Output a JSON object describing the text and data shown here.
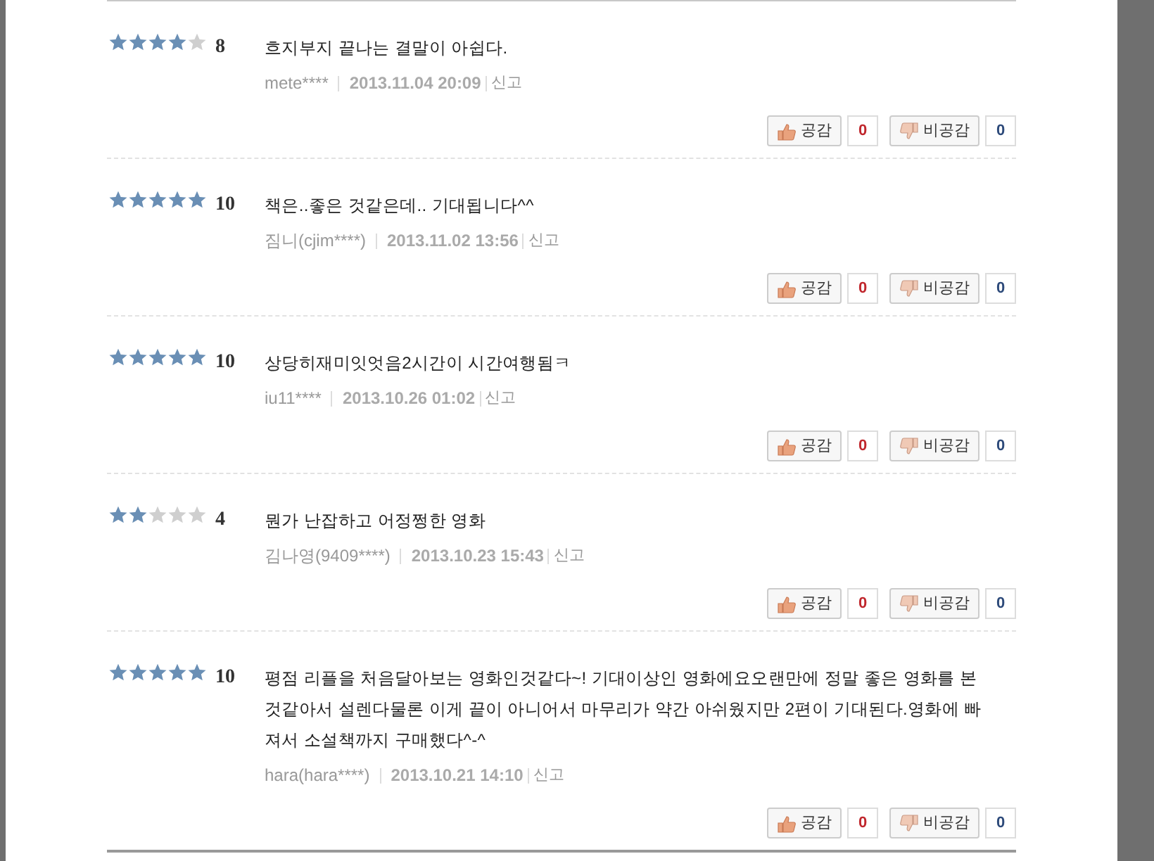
{
  "reviews": [
    {
      "stars": 4,
      "score": "8",
      "text": "흐지부지 끝나는 결말이 아쉽다.",
      "author": "mete****",
      "date": "2013.11.04 20:09",
      "report": "신고",
      "like_label": "공감",
      "like_count": "0",
      "dislike_label": "비공감",
      "dislike_count": "0"
    },
    {
      "stars": 5,
      "score": "10",
      "text": "책은..좋은 것같은데.. 기대됩니다^^",
      "author": "짐니(cjim****)",
      "date": "2013.11.02 13:56",
      "report": "신고",
      "like_label": "공감",
      "like_count": "0",
      "dislike_label": "비공감",
      "dislike_count": "0"
    },
    {
      "stars": 5,
      "score": "10",
      "text": "상당히재미잇엇음2시간이 시간여행됨ㅋ",
      "author": "iu11****",
      "date": "2013.10.26 01:02",
      "report": "신고",
      "like_label": "공감",
      "like_count": "0",
      "dislike_label": "비공감",
      "dislike_count": "0"
    },
    {
      "stars": 2,
      "score": "4",
      "text": "뭔가 난잡하고 어정쩡한 영화",
      "author": "김나영(9409****)",
      "date": "2013.10.23 15:43",
      "report": "신고",
      "like_label": "공감",
      "like_count": "0",
      "dislike_label": "비공감",
      "dislike_count": "0"
    },
    {
      "stars": 5,
      "score": "10",
      "text": "평점 리플을 처음달아보는 영화인것같다~! 기대이상인 영화에요오랜만에 정말 좋은 영화를 본것같아서 설렌다물론 이게 끝이 아니어서 마무리가 약간 아쉬웠지만 2편이 기대된다.영화에 빠져서 소설책까지 구매했다^-^",
      "author": "hara(hara****)",
      "date": "2013.10.21 14:10",
      "report": "신고",
      "like_label": "공감",
      "like_count": "0",
      "dislike_label": "비공감",
      "dislike_count": "0"
    }
  ]
}
